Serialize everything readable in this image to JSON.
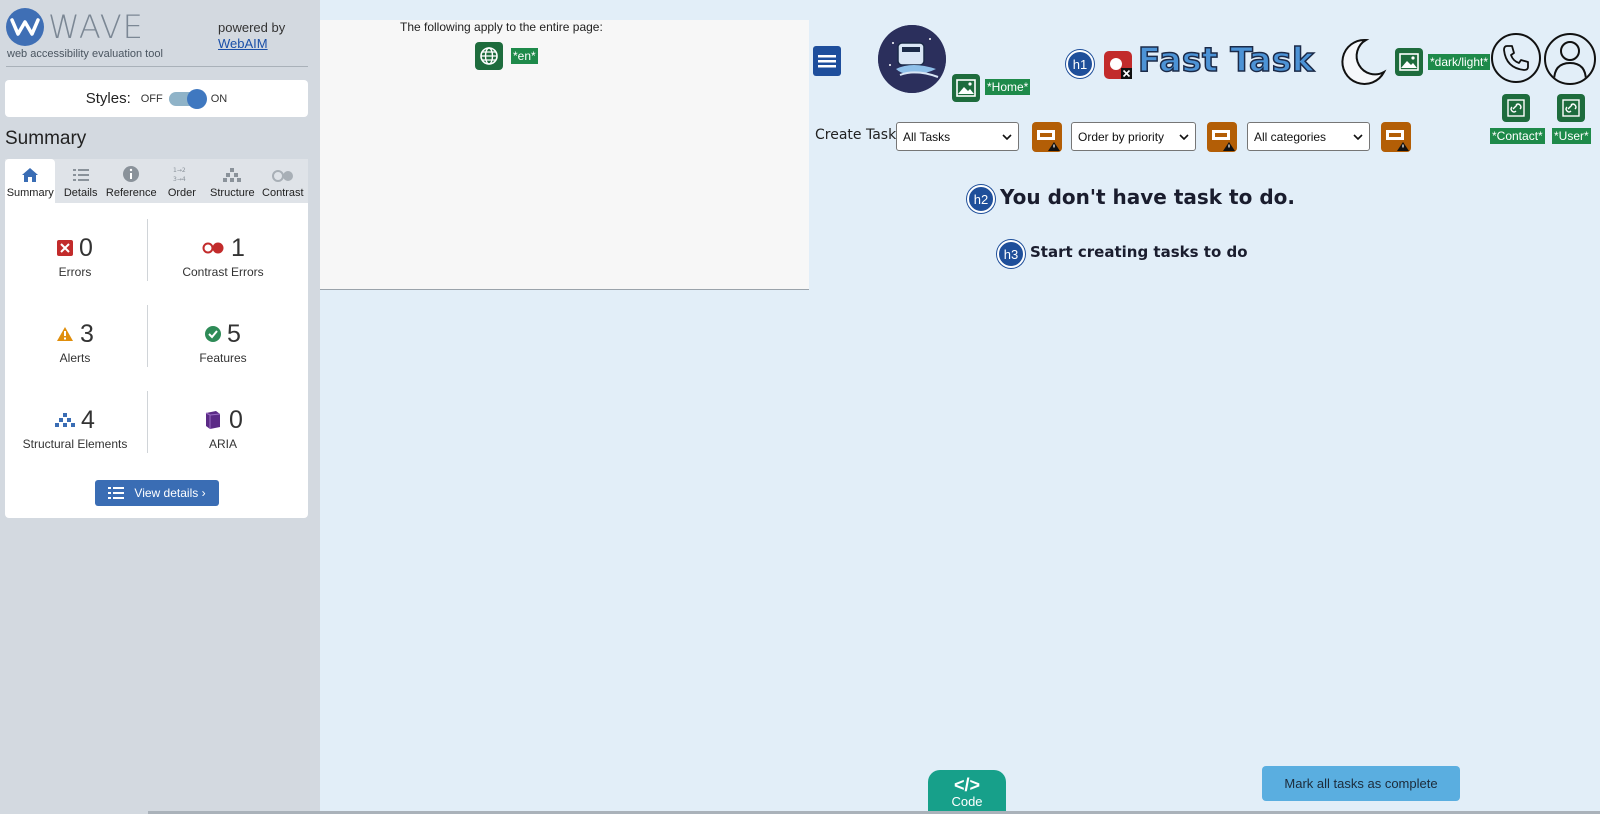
{
  "wave": {
    "brand": "WAVE",
    "tagline": "web accessibility evaluation tool",
    "powered_by": "powered by",
    "powered_link": "WebAIM",
    "styles_label": "Styles:",
    "styles_off": "OFF",
    "styles_on": "ON",
    "summary_title": "Summary",
    "tabs": [
      {
        "label": "Summary",
        "icon": "home-icon"
      },
      {
        "label": "Details",
        "icon": "list-icon"
      },
      {
        "label": "Reference",
        "icon": "info-icon"
      },
      {
        "label": "Order",
        "icon": "order-icon"
      },
      {
        "label": "Structure",
        "icon": "structure-icon"
      },
      {
        "label": "Contrast",
        "icon": "contrast-icon"
      }
    ],
    "stats": {
      "errors": {
        "count": "0",
        "label": "Errors"
      },
      "contrast_errors": {
        "count": "1",
        "label": "Contrast Errors"
      },
      "alerts": {
        "count": "3",
        "label": "Alerts"
      },
      "features": {
        "count": "5",
        "label": "Features"
      },
      "structural": {
        "count": "4",
        "label": "Structural Elements"
      },
      "aria": {
        "count": "0",
        "label": "ARIA"
      }
    },
    "view_details": "View details ›"
  },
  "page_panel": {
    "notice": "The following apply to the entire page:",
    "lang_tag": "*en*"
  },
  "app": {
    "title": "Fast Task",
    "home_tag": "*Home*",
    "dark_light_tag": "*dark/light*",
    "contact_tag": "*Contact*",
    "user_tag": "*User*",
    "h1_badge": "h1",
    "h2_badge": "h2",
    "h3_badge": "h3",
    "create_task": "Create Task",
    "filters": {
      "tasks": "All Tasks",
      "order": "Order by priority",
      "categories": "All categories"
    },
    "empty_heading": "You don't have task to do.",
    "empty_sub": "Start creating tasks to do",
    "mark_all": "Mark all tasks as complete",
    "code_symbol": "</>",
    "code_label": "Code"
  },
  "colors": {
    "wave_blue": "#3a6db4",
    "feature_green": "#1e6c3d",
    "alert_orange": "#b35e06",
    "error_red": "#c22b2b",
    "app_bg": "#e2eef8",
    "code_teal": "#17a08a",
    "mark_all_blue": "#5aaee0"
  }
}
